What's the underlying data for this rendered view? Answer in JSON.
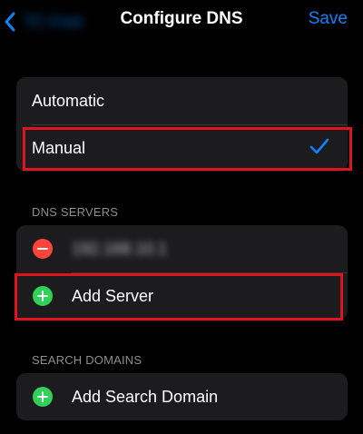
{
  "nav": {
    "back_label": "TC Fnet",
    "title": "Configure DNS",
    "save_label": "Save"
  },
  "mode": {
    "automatic_label": "Automatic",
    "manual_label": "Manual",
    "selected": "Manual"
  },
  "dns_servers": {
    "header": "DNS SERVERS",
    "entries": [
      "192.168.10.1"
    ],
    "add_label": "Add Server"
  },
  "search_domains": {
    "header": "SEARCH DOMAINS",
    "add_label": "Add Search Domain"
  },
  "colors": {
    "accent": "#0a84ff",
    "background": "#000000",
    "card": "#1c1c1e",
    "remove": "#ff453a",
    "add": "#30d158",
    "annotation": "#e0141e"
  },
  "icons": [
    "chevron-left-icon",
    "checkmark-icon",
    "minus-circle-icon",
    "plus-circle-icon"
  ]
}
